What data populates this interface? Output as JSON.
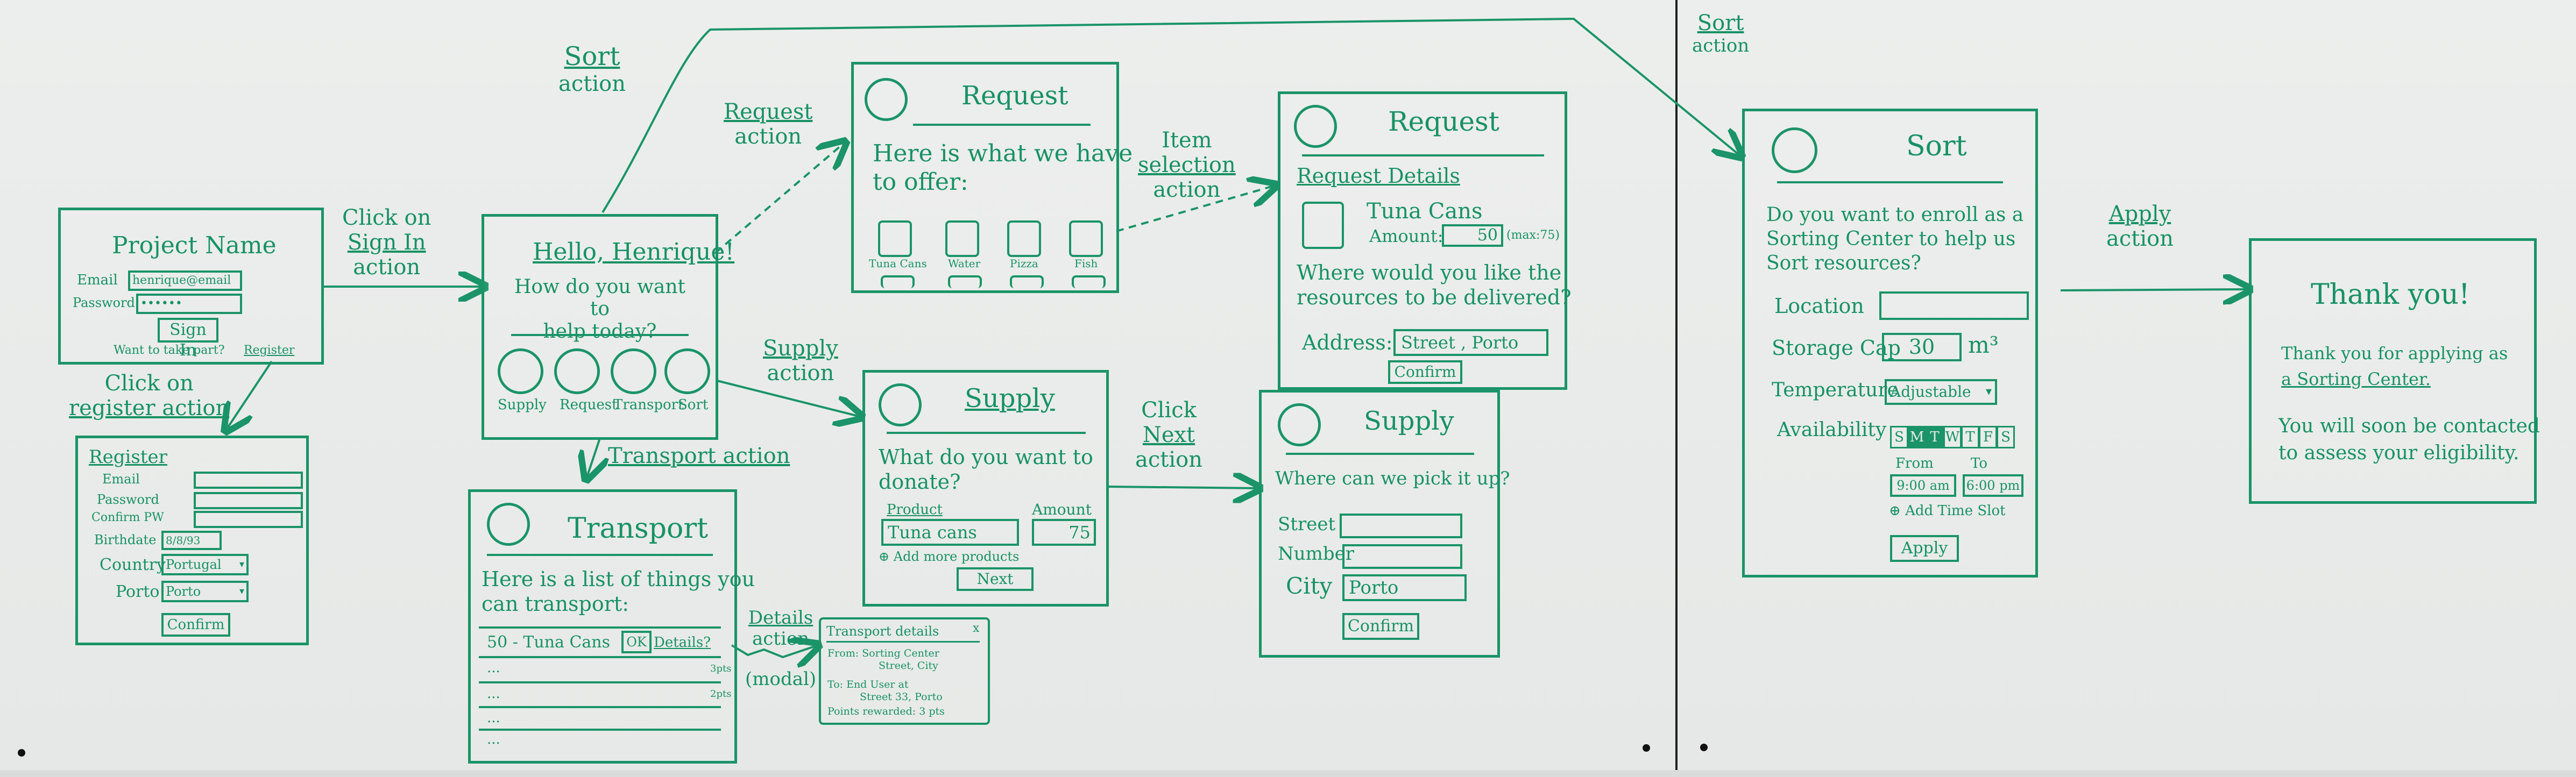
{
  "annotations": {
    "click_sign_in": [
      "Click on",
      "Sign In",
      "action"
    ],
    "click_register": [
      "Click on",
      "register action"
    ],
    "sort_action_left": [
      "Sort",
      "action"
    ],
    "request_action": [
      "Request",
      "action"
    ],
    "supply_action": [
      "Supply",
      "action"
    ],
    "transport_action": "Transport action",
    "item_selection": [
      "Item",
      "selection",
      "action"
    ],
    "click_next": [
      "Click",
      "Next",
      "action"
    ],
    "details_action": [
      "Details",
      "action",
      "(modal)"
    ],
    "sort_action_right": [
      "Sort",
      "action"
    ],
    "apply_action": [
      "Apply",
      "action"
    ]
  },
  "login": {
    "title": "Project Name",
    "email_label": "Email",
    "email_value": "henrique@email",
    "password_label": "Password",
    "password_value": "••••••",
    "sign_in": "Sign In",
    "help_text": "Want to take part?",
    "register_link": "Register"
  },
  "register": {
    "title": "Register",
    "fields": [
      "Email",
      "Password",
      "Confirm PW",
      "Birthdate",
      "Country",
      "Porto"
    ],
    "birthdate_value": "8/8/93",
    "country_value": "Portugal",
    "city_value": "Porto",
    "confirm": "Confirm"
  },
  "home": {
    "greeting": "Hello, Henrique!",
    "question": [
      "How do you want to",
      "help today?"
    ],
    "options": [
      "Supply",
      "Request",
      "Transport",
      "Sort"
    ]
  },
  "request1": {
    "title": "Request",
    "text": [
      "Here is what we have",
      "to offer:"
    ],
    "items": [
      "Tuna Cans",
      "Water",
      "Pizza",
      "Fish"
    ]
  },
  "request2": {
    "title": "Request",
    "details_heading": "Request Details",
    "item_name": "Tuna Cans",
    "amount_label": "Amount:",
    "amount_value": "50",
    "amount_max": "(max:75)",
    "question": [
      "Where would you like the",
      "resources to be delivered?"
    ],
    "address_label": "Address:",
    "address_value": "Street , Porto",
    "confirm": "Confirm"
  },
  "supply1": {
    "title": "Supply",
    "question": [
      "What do you want to",
      "donate?"
    ],
    "product_label": "Product",
    "product_value": "Tuna cans",
    "amount_label": "Amount",
    "amount_value": "75",
    "add_more": "Add more products",
    "next": "Next"
  },
  "supply2": {
    "title": "Supply",
    "question": "Where can we pick it up?",
    "street_label": "Street",
    "number_label": "Number",
    "city_label": "City",
    "city_value": "Porto",
    "confirm": "Confirm"
  },
  "transport": {
    "title": "Transport",
    "text": [
      "Here is a list of things you",
      "can transport:"
    ],
    "row_text": "50 - Tuna Cans",
    "ok": "OK",
    "details": "Details?",
    "pts": [
      "3pts",
      "2pts"
    ],
    "dots": "..."
  },
  "transport_modal": {
    "title": "Transport details",
    "close": "x",
    "from": [
      "From: Sorting Center",
      "Street, City"
    ],
    "to": [
      "To: End User at",
      "Street 33, Porto"
    ],
    "points": "Points rewarded: 3 pts"
  },
  "sort": {
    "title": "Sort",
    "question": [
      "Do you want to enroll as a",
      "Sorting Center to help us",
      "Sort resources?"
    ],
    "location_label": "Location",
    "storage_label": "Storage Cap",
    "storage_value": "30",
    "storage_unit": "m³",
    "temperature_label": "Temperature",
    "temperature_value": "Adjustable",
    "availability_label": "Availability",
    "days": [
      "S",
      "M",
      "T",
      "W",
      "T",
      "F",
      "S"
    ],
    "from_label": "From",
    "to_label": "To",
    "from_value": "9:00 am",
    "to_value": "6:00 pm",
    "add_slot": "Add Time Slot",
    "apply": "Apply"
  },
  "thanks": {
    "title": "Thank you!",
    "line1": [
      "Thank you for applying as",
      "a Sorting Center."
    ],
    "line2": [
      "You will soon be contacted",
      "to assess your eligibility."
    ]
  },
  "colors": {
    "ink": "#179264",
    "board": "#e9ebea"
  }
}
